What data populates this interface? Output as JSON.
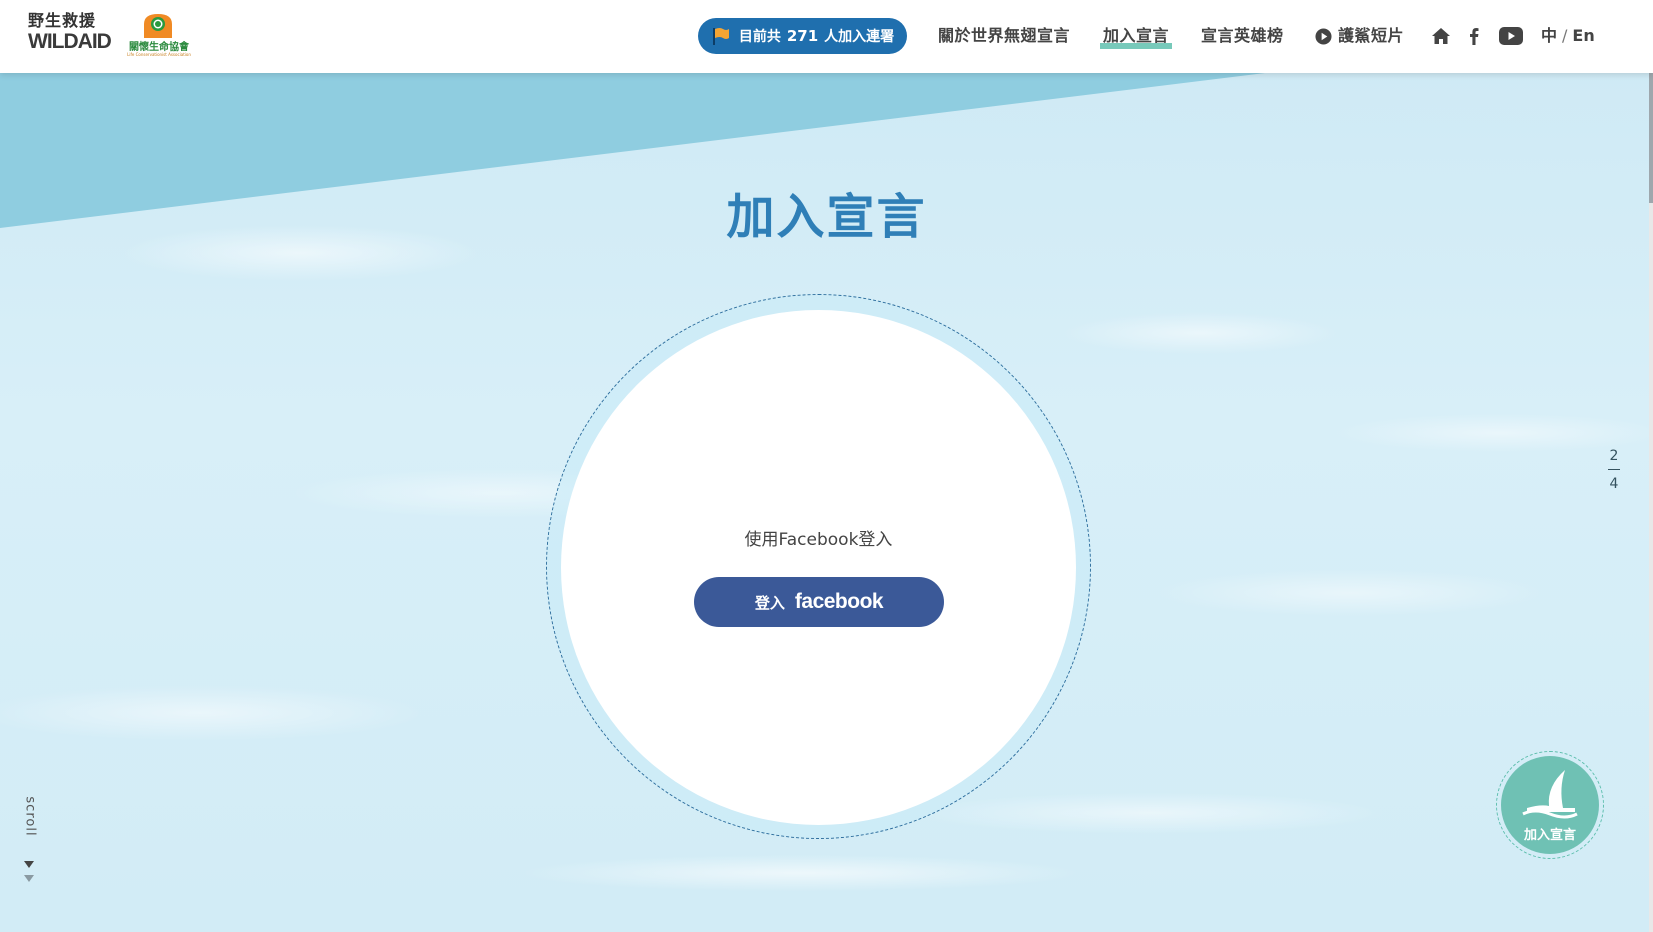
{
  "header": {
    "logo_wildaid_cn": "野生救援",
    "logo_wildaid_en": "WILDAID",
    "logo_lca_cn": "關懷生命協會",
    "logo_lca_en": "Life Conservationist Association",
    "signed_prefix": "目前共",
    "signed_count": "271",
    "signed_suffix": "人加入連署",
    "nav": {
      "about": "關於世界無翅宣言",
      "join": "加入宣言",
      "heroes": "宣言英雄榜",
      "video": "護鯊短片"
    },
    "lang_zh": "中",
    "lang_sep": "/",
    "lang_en": "En"
  },
  "hero": {
    "title": "加入宣言",
    "login_prompt": "使用Facebook登入",
    "fb_button_zh": "登入",
    "fb_button_brand": "facebook"
  },
  "pager": {
    "current": "2",
    "total": "4"
  },
  "scroll_label": "scroll",
  "join_badge_label": "加入宣言",
  "colors": {
    "pill": "#1f6fae",
    "title": "#2f7fb7",
    "facebook": "#3b5998",
    "nav_active_underline": "#5fbfae",
    "badge": "#6fc1b4",
    "sea": "#d2ecf6"
  },
  "icons": {
    "pill_icon": "flag-icon",
    "video_icon": "play-circle-icon",
    "home": "home-icon",
    "facebook": "facebook-icon",
    "youtube": "youtube-icon",
    "scroll": "chevron-down-icon",
    "badge": "shark-fin-icon"
  }
}
